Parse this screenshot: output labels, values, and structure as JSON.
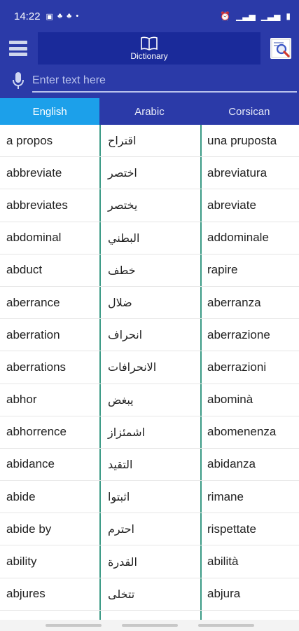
{
  "status_bar": {
    "time": "14:22",
    "left_icons": [
      "image-icon",
      "notification-icon",
      "notification-icon",
      "dot-icon"
    ],
    "right_icons": [
      "alarm-icon",
      "signal-icon",
      "signal-icon",
      "battery-icon"
    ]
  },
  "app_bar": {
    "title": "Dictionary",
    "colors": {
      "bar": "#2b3aa8",
      "title_bg": "#1a2a9a",
      "active_tab": "#1ca0ea",
      "divider": "#3a9a85"
    }
  },
  "search": {
    "placeholder": "Enter text here",
    "value": ""
  },
  "tabs": [
    {
      "label": "English",
      "active": true
    },
    {
      "label": "Arabic",
      "active": false
    },
    {
      "label": "Corsican",
      "active": false
    }
  ],
  "rows": [
    {
      "en": "a propos",
      "ar": "اقتراح",
      "co": "una pruposta"
    },
    {
      "en": "abbreviate",
      "ar": "اختصر",
      "co": "abreviatura"
    },
    {
      "en": "abbreviates",
      "ar": "يختصر",
      "co": "abreviate"
    },
    {
      "en": "abdominal",
      "ar": "البطني",
      "co": "addominale"
    },
    {
      "en": "abduct",
      "ar": "خطف",
      "co": "rapire"
    },
    {
      "en": "aberrance",
      "ar": "ضلال",
      "co": "aberranza"
    },
    {
      "en": "aberration",
      "ar": "انحراف",
      "co": "aberrazione"
    },
    {
      "en": "aberrations",
      "ar": "الانحرافات",
      "co": "aberrazioni"
    },
    {
      "en": "abhor",
      "ar": "يبغض",
      "co": "abominà"
    },
    {
      "en": "abhorrence",
      "ar": "اشمئزاز",
      "co": "abomenenza"
    },
    {
      "en": "abidance",
      "ar": "التقيد",
      "co": "abidanza"
    },
    {
      "en": "abide",
      "ar": "اثبتوا",
      "co": "rimane"
    },
    {
      "en": "abide by",
      "ar": "احترم",
      "co": "rispettate"
    },
    {
      "en": "ability",
      "ar": "القدرة",
      "co": "abilità"
    },
    {
      "en": "abjures",
      "ar": "تتخلى",
      "co": "abjura"
    }
  ]
}
